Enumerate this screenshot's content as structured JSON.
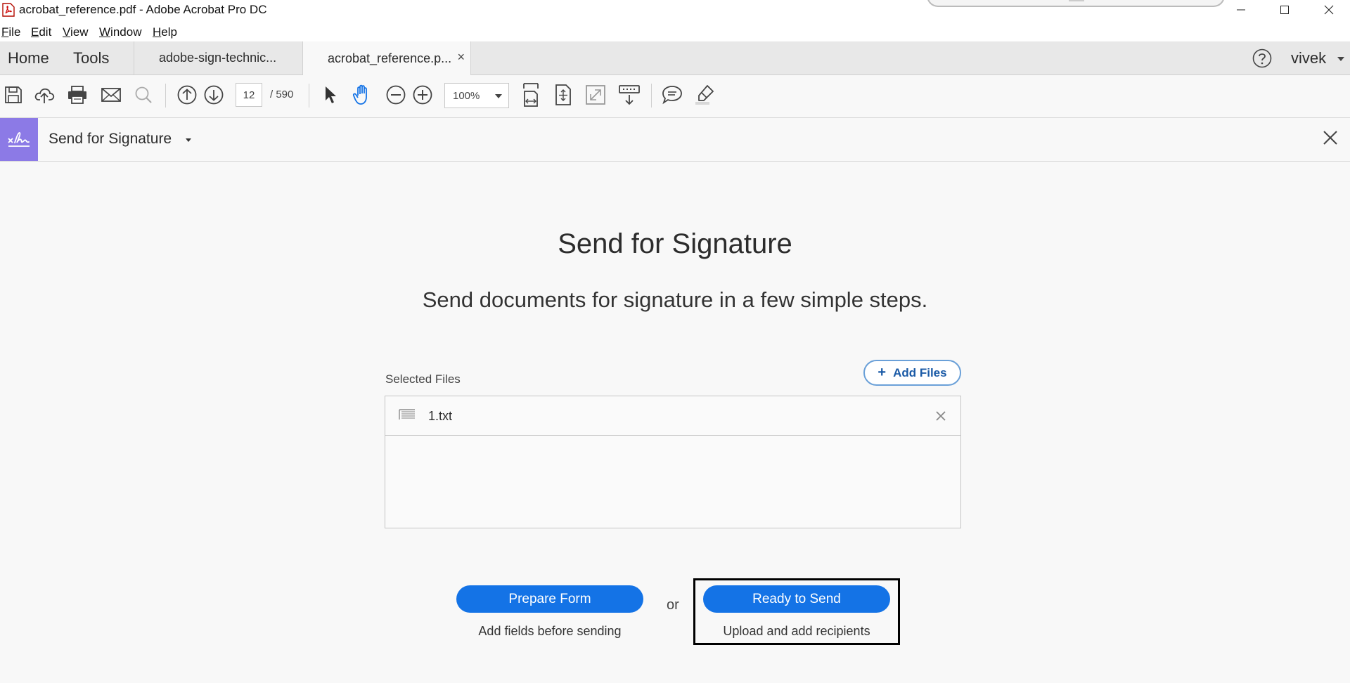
{
  "window": {
    "title": "acrobat_reference.pdf - Adobe Acrobat Pro DC"
  },
  "menu": [
    {
      "accel": "F",
      "rest": "ile"
    },
    {
      "accel": "E",
      "rest": "dit"
    },
    {
      "accel": "V",
      "rest": "iew"
    },
    {
      "accel": "W",
      "rest": "indow"
    },
    {
      "accel": "H",
      "rest": "elp"
    }
  ],
  "tabs": {
    "home": "Home",
    "tools": "Tools",
    "documents": [
      {
        "label": "adobe-sign-technic...",
        "active": false
      },
      {
        "label": "acrobat_reference.p...",
        "active": true
      }
    ],
    "close_glyph": "×",
    "user": "vivek"
  },
  "toolbar": {
    "page_current": "12",
    "page_total": "/ 590",
    "zoom": "100%"
  },
  "tool_header": {
    "title": "Send for Signature",
    "accent_color": "#8c7ae6"
  },
  "main": {
    "title": "Send for Signature",
    "subtitle": "Send documents for signature in a few simple steps.",
    "selected_files_label": "Selected Files",
    "add_files_label": "Add Files",
    "files": [
      {
        "name": "1.txt"
      }
    ],
    "prepare_form": {
      "label": "Prepare Form",
      "caption": "Add fields before sending"
    },
    "or_text": "or",
    "ready_to_send": {
      "label": "Ready to Send",
      "caption": "Upload and add recipients"
    },
    "primary_color": "#1473e6"
  }
}
